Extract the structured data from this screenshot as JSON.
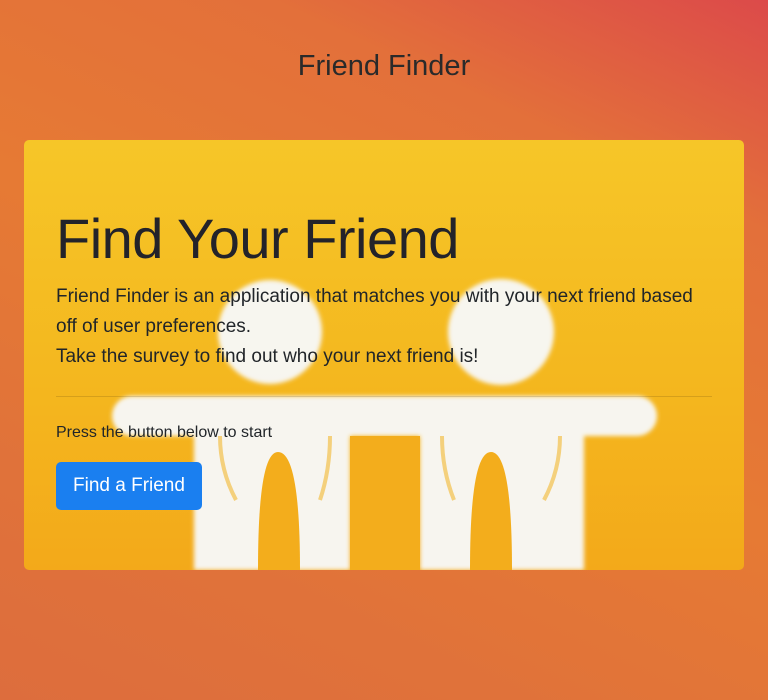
{
  "header": {
    "title": "Friend Finder"
  },
  "jumbotron": {
    "heading": "Find Your Friend",
    "lead_line_1": "Friend Finder is an application that matches you with your next friend based off of user preferences.",
    "lead_line_2": "Take the survey to find out who your next friend is!",
    "hint": "Press the button below to start",
    "button_label": "Find a Friend",
    "background_image": "friends-holding-hands-icon"
  },
  "colors": {
    "page_gradient_start": "#dc4a4a",
    "page_gradient_end": "#e67a34",
    "card_background": "#f5bc22",
    "button_primary": "#1a7ff0",
    "button_text": "#ffffff"
  }
}
